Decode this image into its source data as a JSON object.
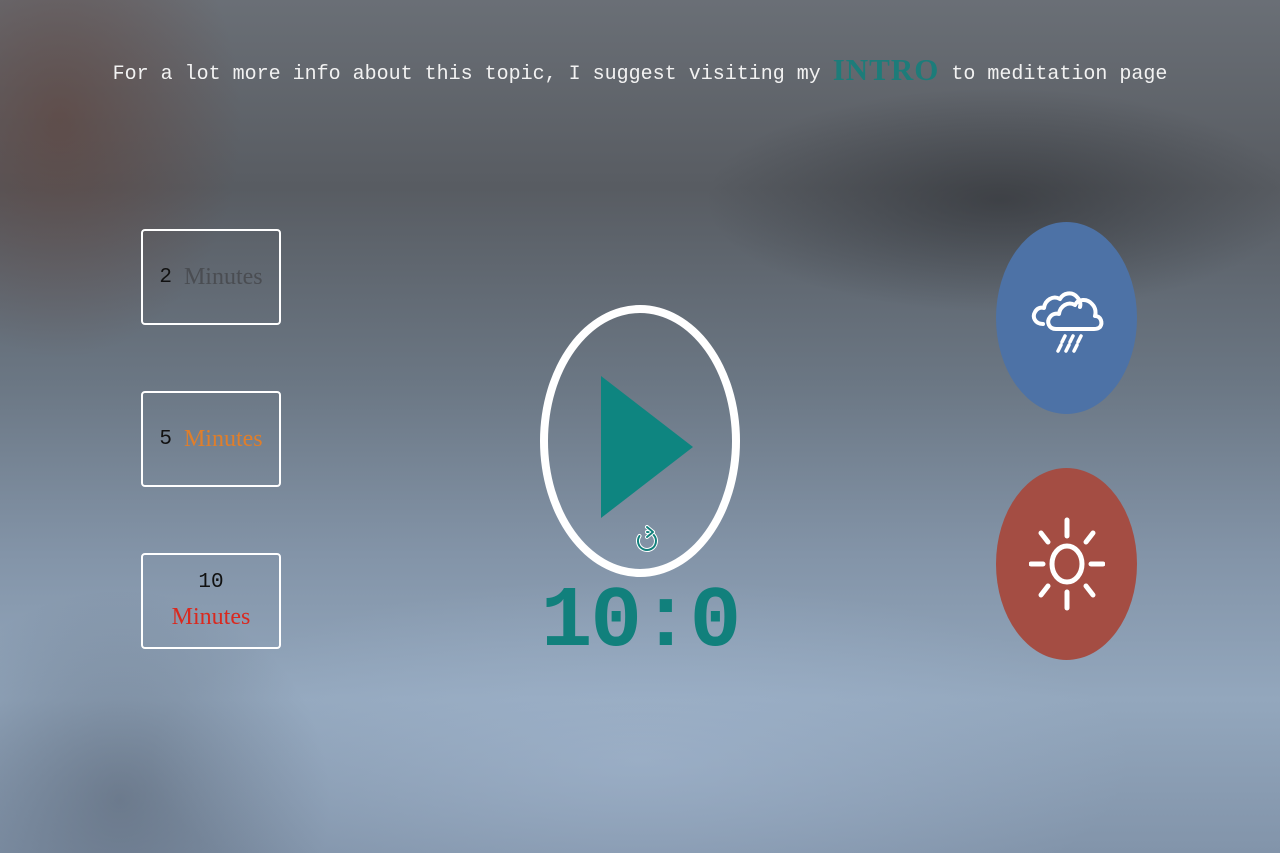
{
  "header": {
    "text_before": "For a lot more info about this topic, I suggest visiting my ",
    "link_label": "INTRO",
    "text_after": " to meditation page"
  },
  "durations": [
    {
      "number": "2",
      "unit": "Minutes",
      "unit_color": "#4a4d52"
    },
    {
      "number": "5",
      "unit": "Minutes",
      "unit_color": "#e07e2a"
    },
    {
      "number": "10",
      "unit": "Minutes",
      "unit_color": "#d9291f"
    }
  ],
  "player": {
    "play_icon": "play-icon",
    "reset_icon": "reset-icon",
    "timer": "10:0"
  },
  "sounds": [
    {
      "icon": "rain-cloud-icon",
      "color": "#4d72a6"
    },
    {
      "icon": "sun-icon",
      "color": "#a44d43"
    }
  ],
  "colors": {
    "accent": "#11807c",
    "ring": "#ffffff"
  }
}
